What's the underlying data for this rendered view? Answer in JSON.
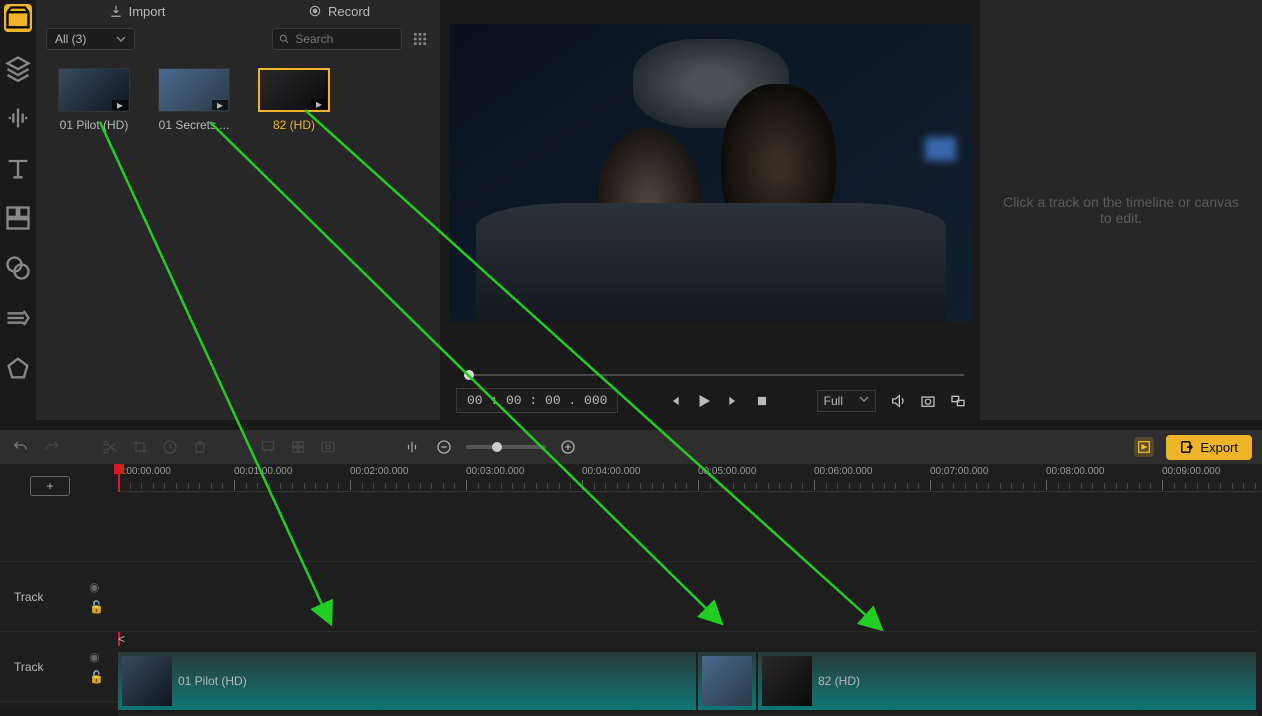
{
  "tabs": {
    "import": "Import",
    "record": "Record"
  },
  "filter": {
    "label": "All (3)"
  },
  "search": {
    "placeholder": "Search"
  },
  "media": [
    {
      "label": "01 Pilot (HD)"
    },
    {
      "label": "01 Secrets ..."
    },
    {
      "label": "82 (HD)"
    }
  ],
  "preview": {
    "timecode": "00 : 00 : 00 . 000",
    "fit": "Full"
  },
  "right_panel": {
    "hint": "Click a track on the timeline or canvas to edit."
  },
  "toolbar": {
    "export": "Export"
  },
  "ruler": {
    "ticks": [
      "0:00:00.000",
      "00:01:00.000",
      "00:02:00.000",
      "00:03:00.000",
      "00:04:00.000",
      "00:05:00.000",
      "00:06:00.000",
      "00:07:00.000",
      "00:08:00.000",
      "00:09:00.000"
    ]
  },
  "tracks": {
    "label": "Track",
    "clips": [
      {
        "label": "01 Pilot (HD)"
      },
      {
        "label": ""
      },
      {
        "label": "82 (HD)"
      }
    ]
  },
  "addtrack": "+"
}
